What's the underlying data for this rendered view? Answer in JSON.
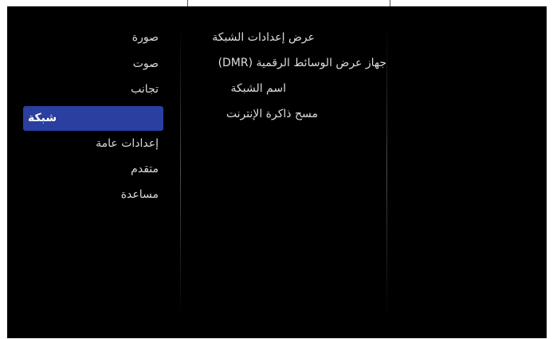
{
  "menu": {
    "main_items": [
      {
        "label": "صورة",
        "selected": false
      },
      {
        "label": "صوت",
        "selected": false
      },
      {
        "label": "تجانب",
        "selected": false
      },
      {
        "label": "شبكة",
        "selected": true
      },
      {
        "label": "إعدادات عامة",
        "selected": false
      },
      {
        "label": "متقدم",
        "selected": false
      },
      {
        "label": "مساعدة",
        "selected": false
      }
    ],
    "sub_items": [
      {
        "label": "عرض إعدادات الشبكة"
      },
      {
        "label": "جهاز عرض الوسائط الرقمية (DMR)"
      },
      {
        "label": "اسم الشبكة"
      },
      {
        "label": "مسح ذاكرة الإنترنت"
      }
    ]
  },
  "colors": {
    "background": "#000000",
    "selection": "#2a3f9f",
    "text": "#d9d9d9"
  }
}
